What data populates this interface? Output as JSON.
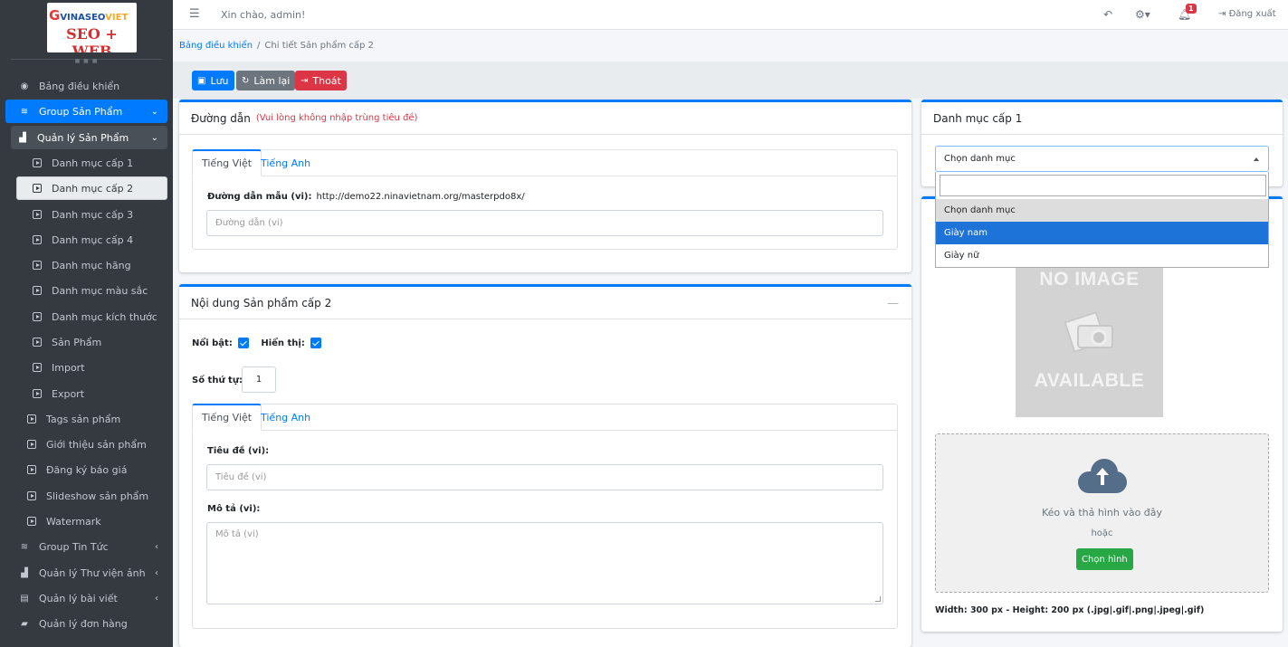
{
  "logo": {
    "top_text_g": "G",
    "top_text_brand": "VINASEO",
    "top_text_brand2": "VIET",
    "bottom_text": "SEO + WEB"
  },
  "topbar": {
    "greeting": "Xin chào, admin!",
    "notif_count": "1",
    "logout_label": "Đăng xuất"
  },
  "breadcrumb": {
    "home": "Bảng điều khiển",
    "separator": "/",
    "current": "Chi tiết Sản phẩm cấp 2"
  },
  "sidebar": {
    "items": [
      {
        "label": "Bảng điều khiển",
        "icon": "dashboard-icon"
      },
      {
        "label": "Group Sản Phẩm",
        "icon": "layers-icon"
      },
      {
        "label": "Quản lý Sản Phẩm",
        "icon": "boxes-icon"
      },
      {
        "label": "Danh mục cấp 1",
        "icon": "caret-square-icon"
      },
      {
        "label": "Danh mục cấp 2",
        "icon": "caret-square-icon"
      },
      {
        "label": "Danh mục cấp 3",
        "icon": "caret-square-icon"
      },
      {
        "label": "Danh mục cấp 4",
        "icon": "caret-square-icon"
      },
      {
        "label": "Danh mục hãng",
        "icon": "caret-square-icon"
      },
      {
        "label": "Danh mục màu sắc",
        "icon": "caret-square-icon"
      },
      {
        "label": "Danh mục kích thước",
        "icon": "caret-square-icon"
      },
      {
        "label": "Sản Phẩm",
        "icon": "caret-square-icon"
      },
      {
        "label": "Import",
        "icon": "caret-square-icon"
      },
      {
        "label": "Export",
        "icon": "caret-square-icon"
      },
      {
        "label": "Tags sản phẩm",
        "icon": "caret-square-icon"
      },
      {
        "label": "Giới thiệu sản phẩm",
        "icon": "caret-square-icon"
      },
      {
        "label": "Đăng ký báo giá",
        "icon": "caret-square-icon"
      },
      {
        "label": "Slideshow sản phẩm",
        "icon": "caret-square-icon"
      },
      {
        "label": "Watermark",
        "icon": "caret-square-icon"
      },
      {
        "label": "Group Tin Tức",
        "icon": "layers-icon"
      },
      {
        "label": "Quản lý Thư viện ảnh",
        "icon": "boxes-icon"
      },
      {
        "label": "Quản lý bài viết",
        "icon": "newspaper-icon"
      },
      {
        "label": "Quản lý đơn hàng",
        "icon": "shopping-bag-icon"
      }
    ]
  },
  "toolbar": {
    "save_label": "Lưu",
    "reset_label": "Làm lại",
    "exit_label": "Thoát"
  },
  "path_card": {
    "title": "Đường dẫn",
    "note": "(Vui lòng không nhập trùng tiêu đề)",
    "tabs": [
      "Tiếng Việt",
      "Tiếng Anh"
    ],
    "sample_label": "Đường dẫn mẫu (vi):",
    "sample_value": "http://demo22.ninavietnam.org/masterpdo8x/",
    "input_placeholder": "Đường dẫn (vi)"
  },
  "content_card": {
    "title": "Nội dung Sản phẩm cấp 2",
    "featured_label": "Nổi bật:",
    "visible_label": "Hiển thị:",
    "order_label": "Số thứ tự:",
    "order_value": "1",
    "tabs": [
      "Tiếng Việt",
      "Tiếng Anh"
    ],
    "title_label": "Tiêu đề (vi):",
    "title_placeholder": "Tiêu đề (vi)",
    "desc_label": "Mô tả (vi):",
    "desc_placeholder": "Mô tả (vi)"
  },
  "category_card": {
    "title": "Danh mục cấp 1",
    "selected": "Chọn danh mục",
    "options": [
      "Chọn danh mục",
      "Giày nam",
      "Giày nữ"
    ],
    "highlighted_option": "Giày nam"
  },
  "image_card": {
    "placeholder_text_top": "NO IMAGE",
    "placeholder_text_bottom": "AVAILABLE",
    "drop_text": "Kéo và thả hình vào đây",
    "or_text": "hoặc",
    "pick_button": "Chọn hình",
    "size_note": "Width: 300 px - Height: 200 px (.jpg|.gif|.png|.jpeg|.gif)"
  },
  "colors": {
    "primary": "#007bff",
    "danger": "#dc3545",
    "success": "#28a745",
    "secondary": "#6c757d",
    "sidebar_bg": "#343a40"
  }
}
